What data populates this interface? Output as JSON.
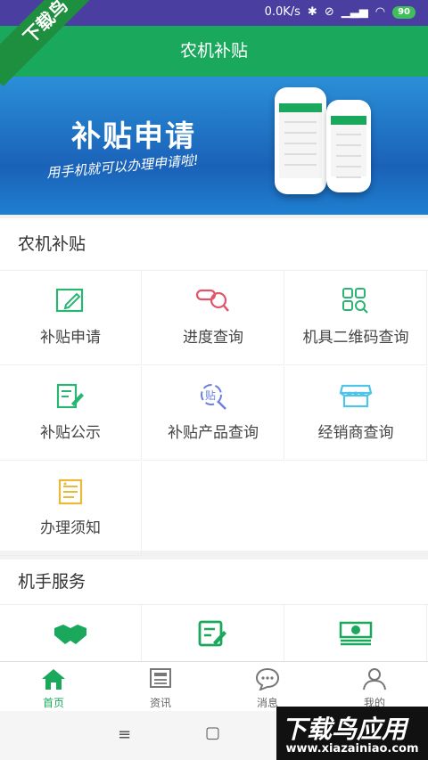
{
  "status_bar": {
    "speed": "0.0K/s",
    "battery": "90"
  },
  "corner_badge": "下载鸟",
  "header": {
    "title": "农机补贴"
  },
  "banner": {
    "title": "补贴申请",
    "subtitle": "用手机就可以办理申请啦!"
  },
  "subsidy_section": {
    "title": "农机补贴",
    "items": [
      {
        "label": "补贴申请",
        "icon": "edit-icon",
        "color": "#2ab573"
      },
      {
        "label": "进度查询",
        "icon": "search-progress-icon",
        "color": "#e0556a"
      },
      {
        "label": "机具二维码查询",
        "icon": "qrcode-search-icon",
        "color": "#2ab573"
      },
      {
        "label": "补贴公示",
        "icon": "clipboard-edit-icon",
        "color": "#2ab573"
      },
      {
        "label": "补贴产品查询",
        "icon": "product-search-icon",
        "color": "#6b7fe0"
      },
      {
        "label": "经销商查询",
        "icon": "shop-icon",
        "color": "#4fc3e8"
      },
      {
        "label": "办理须知",
        "icon": "notice-icon",
        "color": "#e8b93a"
      }
    ]
  },
  "service_section": {
    "title": "机手服务",
    "items": [
      {
        "icon": "handshake-icon"
      },
      {
        "icon": "form-edit-icon"
      },
      {
        "icon": "money-icon"
      }
    ]
  },
  "tabs": [
    {
      "label": "首页",
      "icon": "home-icon",
      "active": true
    },
    {
      "label": "资讯",
      "icon": "news-icon",
      "active": false
    },
    {
      "label": "消息",
      "icon": "message-icon",
      "active": false
    },
    {
      "label": "我的",
      "icon": "profile-icon",
      "active": false
    }
  ],
  "system_nav": {
    "menu_glyph": "≡",
    "home_glyph": "▢"
  },
  "watermark": {
    "brand": "下载鸟应用",
    "url": "www.xiazainiao.com"
  },
  "colors": {
    "primary": "#1aa85c",
    "status_bar": "#4a3fa0"
  }
}
